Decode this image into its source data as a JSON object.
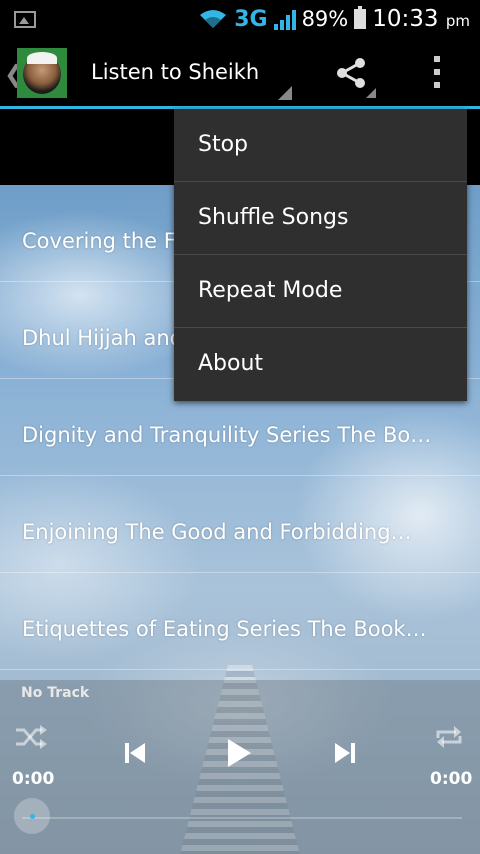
{
  "status_bar": {
    "network": "3G",
    "battery": "89%",
    "time": "10:33",
    "ampm": "pm",
    "signal_level": 1.0,
    "battery_level": 0.89
  },
  "action_bar": {
    "title": "Listen to Sheikh B",
    "icons": [
      "up-caret-icon",
      "app-avatar",
      "share-icon",
      "overflow-menu-icon"
    ]
  },
  "tracks": [
    "Covering the F",
    "Dhul Hijjah and",
    "Dignity and Tranquility Series The Bo…",
    "Enjoining The Good and Forbidding…",
    "Etiquettes of Eating Series The Book…"
  ],
  "player": {
    "now_playing": "No Track",
    "elapsed": "0:00",
    "duration": "0:00",
    "progress": 0,
    "icons": [
      "shuffle-icon",
      "previous-icon",
      "play-icon",
      "next-icon",
      "repeat-icon"
    ]
  },
  "menu": {
    "items": [
      "Stop",
      "Shuffle Songs",
      "Repeat Mode",
      "About"
    ]
  },
  "colors": {
    "accent": "#33b5e5",
    "menu_bg": "#2f2f2f",
    "bar_bg": "#000000"
  }
}
